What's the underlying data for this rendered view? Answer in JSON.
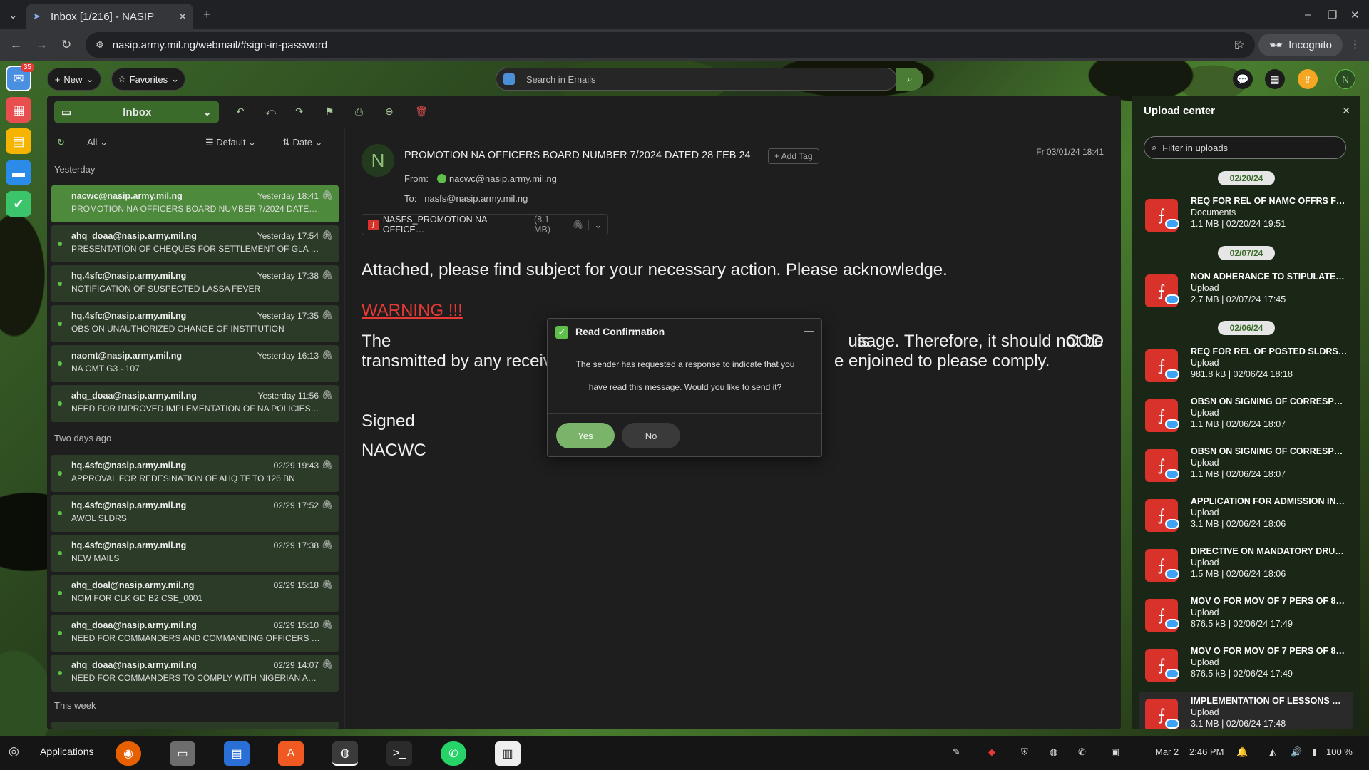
{
  "browser": {
    "tab_title": "Inbox [1/216] - NASIP",
    "url": "nasip.army.mil.ng/webmail/#sign-in-password",
    "incognito": "Incognito"
  },
  "rail": {
    "mail_badge": "35"
  },
  "toolbar": {
    "new_label": "New",
    "favorites_label": "Favorites",
    "search_placeholder": "Search in Emails",
    "user_initial": "N"
  },
  "list": {
    "folder": "Inbox",
    "filter": "All",
    "view": "Default",
    "sort": "Date",
    "groups": [
      "Yesterday",
      "Two days ago",
      "This week"
    ],
    "messages": [
      {
        "from": "nacwc@nasip.army.mil.ng",
        "time": "Yesterday 18:41",
        "subject": "PROMOTION NA OFFICERS BOARD NUMBER 7/2024 DATED 28 FEB 24",
        "selected": true
      },
      {
        "from": "ahq_doaa@nasip.army.mil.ng",
        "time": "Yesterday 17:54",
        "subject": "PRESENTATION OF CHEQUES FOR SETTLEMENT OF GLA …"
      },
      {
        "from": "hq.4sfc@nasip.army.mil.ng",
        "time": "Yesterday 17:38",
        "subject": "NOTIFICATION OF SUSPECTED LASSA FEVER"
      },
      {
        "from": "hq.4sfc@nasip.army.mil.ng",
        "time": "Yesterday 17:35",
        "subject": "OBS ON UNAUTHORIZED CHANGE OF INSTITUTION"
      },
      {
        "from": "naomt@nasip.army.mil.ng",
        "time": "Yesterday 16:13",
        "subject": "NA OMT G3 - 107"
      },
      {
        "from": "ahq_doaa@nasip.army.mil.ng",
        "time": "Yesterday 11:56",
        "subject": "NEED FOR IMPROVED IMPLEMENTATION OF NA POLICIES…"
      },
      {
        "from": "hq.4sfc@nasip.army.mil.ng",
        "time": "02/29 19:43",
        "subject": "APPROVAL FOR REDESINATION OF AHQ TF TO 126 BN"
      },
      {
        "from": "hq.4sfc@nasip.army.mil.ng",
        "time": "02/29 17:52",
        "subject": "AWOL SLDRS"
      },
      {
        "from": "hq.4sfc@nasip.army.mil.ng",
        "time": "02/29 17:38",
        "subject": "NEW MAILS"
      },
      {
        "from": "ahq_doal@nasip.army.mil.ng",
        "time": "02/29 15:18",
        "subject": "NOM FOR CLK GD B2 CSE_0001"
      },
      {
        "from": "ahq_doaa@nasip.army.mil.ng",
        "time": "02/29 15:10",
        "subject": "NEED FOR COMMANDERS AND COMMANDING OFFICERS …"
      },
      {
        "from": "ahq_doaa@nasip.army.mil.ng",
        "time": "02/29 14:07",
        "subject": "NEED FOR COMMANDERS TO COMPLY WITH NIGERIAN A…"
      }
    ]
  },
  "message": {
    "avatar": "N",
    "subject": "PROMOTION NA OFFICERS BOARD NUMBER 7/2024 DATED 28 FEB 24",
    "add_tag": "+ Add Tag",
    "date": "Fr 03/01/24 18:41",
    "from_label": "From:",
    "from": "nacwc@nasip.army.mil.ng",
    "to_label": "To:",
    "to": "nasfs@nasip.army.mil.ng",
    "attachment_name": "NASFS_PROMOTION NA OFFICE…",
    "attachment_size": "(8.1 MB)",
    "body_line1": "Attached, please find subject for your necessary action. Please acknowledge.",
    "warning": "WARNING !!!",
    "body_line2_left": "The document is COD",
    "body_line2_right": "usage. Therefore, it should not be",
    "body_line3_left": "transmitted by any receiv",
    "body_line3_right": "e enjoined to please comply.",
    "signed": "Signed",
    "signer": "NACWC"
  },
  "dialog": {
    "title": "Read Confirmation",
    "text_line1": "The sender has requested a response to indicate that you",
    "text_line2": "have read this message. Would you like to send it?",
    "yes": "Yes",
    "no": "No"
  },
  "uploads": {
    "title": "Upload center",
    "filter_placeholder": "Filter in uploads",
    "dates": [
      "02/20/24",
      "02/07/24",
      "02/06/24"
    ],
    "items": [
      {
        "name": "REQ FOR REL OF NAMC OFFRS F…",
        "kind": "Documents",
        "meta": "1.1 MB | 02/20/24 19:51"
      },
      {
        "name": "NON ADHERANCE TO STIPULATE…",
        "kind": "Upload",
        "meta": "2.7 MB | 02/07/24 17:45"
      },
      {
        "name": "REQ FOR REL OF POSTED SLDRS …",
        "kind": "Upload",
        "meta": "981.8 kB | 02/06/24 18:18"
      },
      {
        "name": "OBSN ON SIGNING OF CORRESP…",
        "kind": "Upload",
        "meta": "1.1 MB | 02/06/24 18:07"
      },
      {
        "name": "OBSN ON SIGNING OF CORRESP…",
        "kind": "Upload",
        "meta": "1.1 MB | 02/06/24 18:07"
      },
      {
        "name": "APPLICATION FOR ADMISSION IN…",
        "kind": "Upload",
        "meta": "3.1 MB | 02/06/24 18:06"
      },
      {
        "name": "DIRECTIVE ON MANDATORY DRU…",
        "kind": "Upload",
        "meta": "1.5 MB | 02/06/24 18:06"
      },
      {
        "name": "MOV O FOR MOV OF 7 PERS OF 8…",
        "kind": "Upload",
        "meta": "876.5 kB | 02/06/24 17:49"
      },
      {
        "name": "MOV O FOR MOV OF 7 PERS OF 8…",
        "kind": "Upload",
        "meta": "876.5 kB | 02/06/24 17:49"
      },
      {
        "name": "IMPLEMENTATION OF LESSONS …",
        "kind": "Upload",
        "meta": "3.1 MB | 02/06/24 17:48"
      }
    ]
  },
  "taskbar": {
    "applications": "Applications",
    "date": "Mar 2",
    "time": "2:46 PM",
    "battery": "100 %"
  },
  "colors": {
    "accent_green": "#4e8a3c",
    "warning_red": "#e53935",
    "pdf_red": "#d9322a"
  }
}
